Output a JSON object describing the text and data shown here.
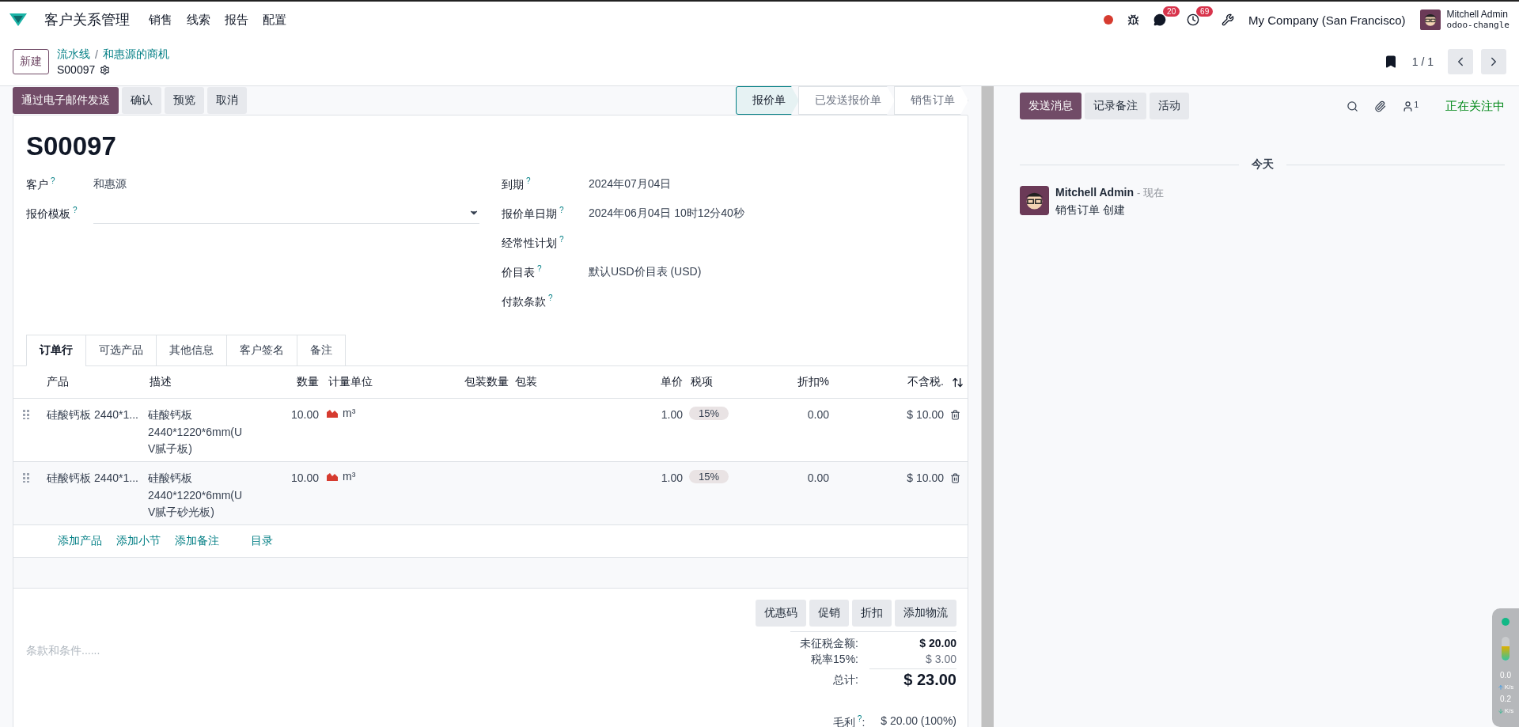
{
  "navbar": {
    "app_name": "客户关系管理",
    "menu": [
      "销售",
      "线索",
      "报告",
      "配置"
    ],
    "messages_count": "20",
    "activities_count": "69",
    "company": "My Company (San Francisco)",
    "user_name": "Mitchell Admin",
    "database": "odoo-changle"
  },
  "control_panel": {
    "new_button": "新建",
    "breadcrumbs": [
      "流水线",
      "和惠源的商机"
    ],
    "separator": "/",
    "record": "S00097",
    "pager": "1 / 1"
  },
  "actions": [
    {
      "label": "通过电子邮件发送",
      "primary": true
    },
    {
      "label": "确认",
      "primary": false
    },
    {
      "label": "预览",
      "primary": false
    },
    {
      "label": "取消",
      "primary": false
    }
  ],
  "statusbar": [
    {
      "label": "报价单",
      "selected": true
    },
    {
      "label": "已发送报价单",
      "selected": false
    },
    {
      "label": "销售订单",
      "selected": false
    }
  ],
  "form": {
    "title": "S00097",
    "left_fields": [
      {
        "label": "客户",
        "help": "?",
        "value": "和惠源",
        "kind": "text"
      },
      {
        "label": "报价模板",
        "help": "?",
        "kind": "select"
      }
    ],
    "right_fields": [
      {
        "label": "到期",
        "help": "?",
        "value": "2024年07月04日"
      },
      {
        "label": "报价单日期",
        "help": "?",
        "value": "2024年06月04日 10时12分40秒"
      },
      {
        "label": "经常性计划",
        "help": "?"
      },
      {
        "label": "价目表",
        "help": "?",
        "value": "默认USD价目表 (USD)"
      },
      {
        "label": "付款条款",
        "help": "?"
      }
    ]
  },
  "tabs": [
    {
      "label": "订单行",
      "selected": true
    },
    {
      "label": "可选产品",
      "selected": false
    },
    {
      "label": "其他信息",
      "selected": false
    },
    {
      "label": "客户签名",
      "selected": false
    },
    {
      "label": "备注",
      "selected": false
    }
  ],
  "table": {
    "columns": [
      "产品",
      "描述",
      "数量",
      "计量单位",
      "包装数量",
      "包装",
      "单价",
      "税项",
      "折扣%",
      "不含税."
    ],
    "rows": [
      {
        "product": "硅酸钙板 2440*1...",
        "description": [
          "硅酸钙板",
          "2440*1220*6mm(U",
          "V腻子板)"
        ],
        "quantity": "10.00",
        "uom": "m³",
        "unit_price": "1.00",
        "tax": "15%",
        "discount": "0.00",
        "subtotal": "$ 10.00"
      },
      {
        "product": "硅酸钙板 2440*1...",
        "description": [
          "硅酸钙板",
          "2440*1220*6mm(U",
          "V腻子砂光板)"
        ],
        "quantity": "10.00",
        "uom": "m³",
        "unit_price": "1.00",
        "tax": "15%",
        "discount": "0.00",
        "subtotal": "$ 10.00"
      }
    ],
    "add_links": [
      "添加产品",
      "添加小节",
      "添加备注",
      "目录"
    ]
  },
  "promo_buttons": [
    "优惠码",
    "促销",
    "折扣",
    "添加物流"
  ],
  "terms": {
    "placeholder": "条款和条件......"
  },
  "totals": [
    {
      "label": "未征税金额:",
      "value": "$ 20.00",
      "kind": "subtotal"
    },
    {
      "label": "税率15%:",
      "value": "$ 3.00",
      "kind": "tax"
    },
    {
      "label": "总计:",
      "value": "$ 23.00",
      "kind": "total"
    }
  ],
  "margin": {
    "label": "毛利",
    "help": "?",
    "colon": ":",
    "value": "$ 20.00 (100%)"
  },
  "chatter": {
    "buttons": [
      {
        "label": "发送消息",
        "primary": true
      },
      {
        "label": "记录备注",
        "primary": false
      },
      {
        "label": "活动",
        "primary": false
      }
    ],
    "followers_count": "1",
    "follow_status": "正在关注中",
    "date_divider": "今天",
    "messages": [
      {
        "author": "Mitchell Admin",
        "time": "- 现在",
        "body": "销售订单 创建"
      }
    ]
  },
  "net_widget": {
    "level": 0.6,
    "upload": "0.0",
    "upload_unit": "K/s",
    "download": "0.2",
    "download_unit": "K/s"
  }
}
